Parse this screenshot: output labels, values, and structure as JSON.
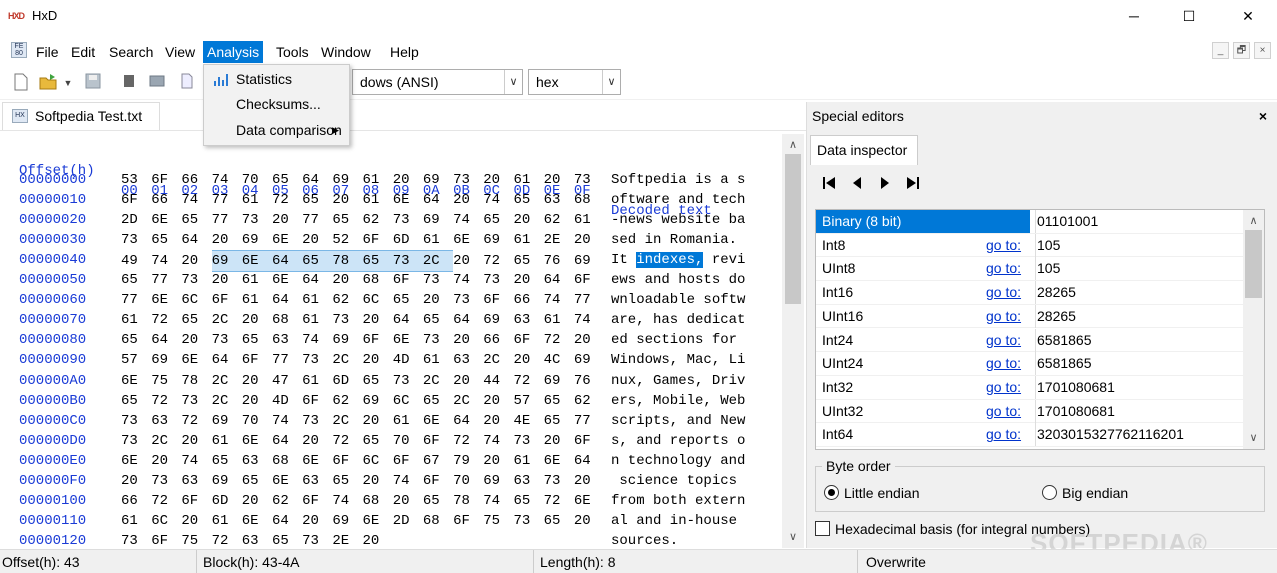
{
  "window": {
    "title": "HxD",
    "app_icon_text": "HXD",
    "minimize": "─",
    "maximize": "☐",
    "close": "✕"
  },
  "menubar": {
    "icon_text": "FE\n80",
    "items": [
      "File",
      "Edit",
      "Search",
      "View",
      "Analysis",
      "Tools",
      "Window",
      "Help"
    ],
    "active": "Analysis",
    "mdi": [
      "_",
      "🗗",
      "×"
    ]
  },
  "toolbar": {
    "encoding": "dows (ANSI)",
    "mode": "hex"
  },
  "analysis_menu": {
    "items": [
      {
        "label": "Statistics",
        "icon": "statistics-icon"
      },
      {
        "label": "Checksums..."
      },
      {
        "label": "Data comparison",
        "submenu": true
      }
    ]
  },
  "doc_tab": {
    "label": "Softpedia Test.txt"
  },
  "hex": {
    "offset_header": "Offset(h)",
    "columns": [
      "00",
      "01",
      "02",
      "03",
      "04",
      "05",
      "06",
      "07",
      "08",
      "09",
      "0A",
      "0B",
      "0C",
      "0D",
      "0E",
      "0F"
    ],
    "decoded_header": "Decoded text",
    "rows": [
      {
        "offset": "00000000",
        "bytes": "53 6F 66 74 70 65 64 69 61 20 69 73 20 61 20 73",
        "text": "Softpedia is a s"
      },
      {
        "offset": "00000010",
        "bytes": "6F 66 74 77 61 72 65 20 61 6E 64 20 74 65 63 68",
        "text": "oftware and tech"
      },
      {
        "offset": "00000020",
        "bytes": "2D 6E 65 77 73 20 77 65 62 73 69 74 65 20 62 61",
        "text": "-news website ba"
      },
      {
        "offset": "00000030",
        "bytes": "73 65 64 20 69 6E 20 52 6F 6D 61 6E 69 61 2E 20",
        "text": "sed in Romania. "
      },
      {
        "offset": "00000040",
        "bytes": "49 74 20 69 6E 64 65 78 65 73 2C 20 72 65 76 69",
        "text": "It indexes, revi",
        "sel_start": 3,
        "sel_end": 10
      },
      {
        "offset": "00000050",
        "bytes": "65 77 73 20 61 6E 64 20 68 6F 73 74 73 20 64 6F",
        "text": "ews and hosts do"
      },
      {
        "offset": "00000060",
        "bytes": "77 6E 6C 6F 61 64 61 62 6C 65 20 73 6F 66 74 77",
        "text": "wnloadable softw"
      },
      {
        "offset": "00000070",
        "bytes": "61 72 65 2C 20 68 61 73 20 64 65 64 69 63 61 74",
        "text": "are, has dedicat"
      },
      {
        "offset": "00000080",
        "bytes": "65 64 20 73 65 63 74 69 6F 6E 73 20 66 6F 72 20",
        "text": "ed sections for "
      },
      {
        "offset": "00000090",
        "bytes": "57 69 6E 64 6F 77 73 2C 20 4D 61 63 2C 20 4C 69",
        "text": "Windows, Mac, Li"
      },
      {
        "offset": "000000A0",
        "bytes": "6E 75 78 2C 20 47 61 6D 65 73 2C 20 44 72 69 76",
        "text": "nux, Games, Driv"
      },
      {
        "offset": "000000B0",
        "bytes": "65 72 73 2C 20 4D 6F 62 69 6C 65 2C 20 57 65 62",
        "text": "ers, Mobile, Web"
      },
      {
        "offset": "000000C0",
        "bytes": "73 63 72 69 70 74 73 2C 20 61 6E 64 20 4E 65 77",
        "text": "scripts, and New"
      },
      {
        "offset": "000000D0",
        "bytes": "73 2C 20 61 6E 64 20 72 65 70 6F 72 74 73 20 6F",
        "text": "s, and reports o"
      },
      {
        "offset": "000000E0",
        "bytes": "6E 20 74 65 63 68 6E 6F 6C 6F 67 79 20 61 6E 64",
        "text": "n technology and"
      },
      {
        "offset": "000000F0",
        "bytes": "20 73 63 69 65 6E 63 65 20 74 6F 70 69 63 73 20",
        "text": " science topics "
      },
      {
        "offset": "00000100",
        "bytes": "66 72 6F 6D 20 62 6F 74 68 20 65 78 74 65 72 6E",
        "text": "from both extern"
      },
      {
        "offset": "00000110",
        "bytes": "61 6C 20 61 6E 64 20 69 6E 2D 68 6F 75 73 65 20",
        "text": "al and in-house "
      },
      {
        "offset": "00000120",
        "bytes": "73 6F 75 72 63 65 73 2E 20",
        "text": "sources. "
      }
    ]
  },
  "special_editors": {
    "title": "Special editors",
    "close": "×",
    "tab": "Data inspector",
    "nav": [
      "⏮",
      "◀",
      "▶",
      "⏭"
    ],
    "goto_label": "go to:",
    "rows": [
      {
        "name": "Binary (8 bit)",
        "goto": false,
        "value": "01101001",
        "selected": true
      },
      {
        "name": "Int8",
        "goto": true,
        "value": "105"
      },
      {
        "name": "UInt8",
        "goto": true,
        "value": "105"
      },
      {
        "name": "Int16",
        "goto": true,
        "value": "28265"
      },
      {
        "name": "UInt16",
        "goto": true,
        "value": "28265"
      },
      {
        "name": "Int24",
        "goto": true,
        "value": "6581865"
      },
      {
        "name": "UInt24",
        "goto": true,
        "value": "6581865"
      },
      {
        "name": "Int32",
        "goto": true,
        "value": "1701080681"
      },
      {
        "name": "UInt32",
        "goto": true,
        "value": "1701080681"
      },
      {
        "name": "Int64",
        "goto": true,
        "value": "3203015327762116201"
      }
    ],
    "byte_order": {
      "legend": "Byte order",
      "little": "Little endian",
      "big": "Big endian",
      "selected": "little"
    },
    "hex_basis": "Hexadecimal basis (for integral numbers)"
  },
  "status": {
    "offset": "Offset(h): 43",
    "block": "Block(h): 43-4A",
    "length": "Length(h): 8",
    "mode": "Overwrite"
  },
  "watermark": "SOFTPEDIA®",
  "colors": {
    "accent": "#0078d7",
    "offset_blue": "#1a3bd6",
    "link": "#0033cc"
  }
}
